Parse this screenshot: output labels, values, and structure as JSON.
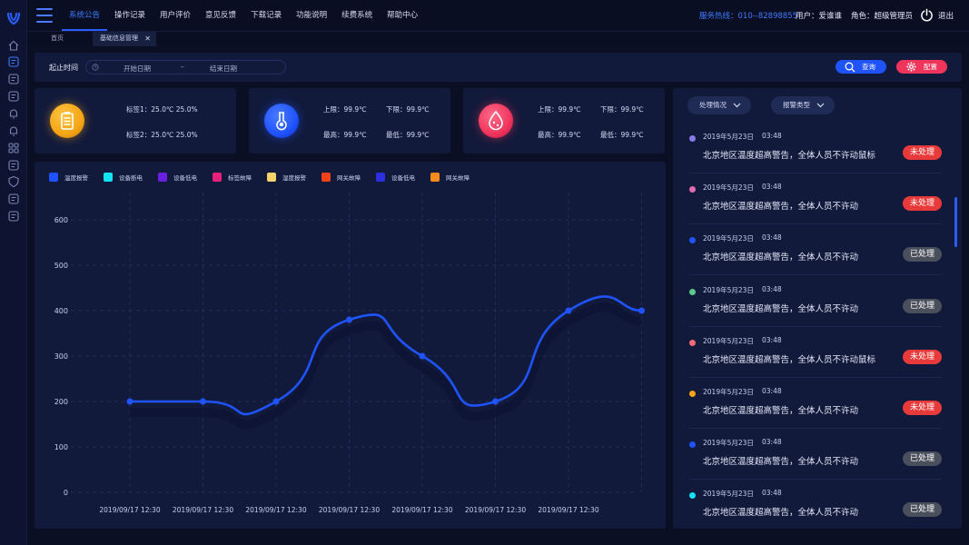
{
  "nav": {
    "items": [
      "系统公告",
      "操作记录",
      "用户评价",
      "意见反馈",
      "下载记录",
      "功能说明",
      "续费系统",
      "帮助中心"
    ],
    "active_index": 0,
    "hotline": "服务热线：010--82898855",
    "user": "用户：爱谁谁",
    "role": "角色：超级管理员",
    "logout": "退出"
  },
  "tabs": {
    "home": "首页",
    "current": "基础信息管理",
    "close": "✕"
  },
  "sidebar": {
    "icons": [
      "home-icon",
      "document-icon",
      "monitor-icon",
      "settings-list-icon",
      "alarm-bell-icon",
      "bell-icon",
      "grid-icon",
      "message-icon",
      "shield-icon",
      "file-icon",
      "search-file-icon"
    ],
    "active_index": 1
  },
  "filter": {
    "label": "起止时间",
    "start_placeholder": "开始日期",
    "separator": "–",
    "end_placeholder": "结束日期",
    "query_label": "查询",
    "config_label": "配置"
  },
  "cards": [
    {
      "icon": "battery-icon",
      "color": "#f5a515",
      "line1a": "标签1：25.0℃  25.0%",
      "line2a": "标签2：25.0℃  25.0%"
    },
    {
      "icon": "thermometer-icon",
      "color": "#1f53ff",
      "upper": "上限：99.9℃",
      "lower": "下限：99.9℃",
      "max": "最高：99.9℃",
      "min": "最低：99.9℃"
    },
    {
      "icon": "humidity-icon",
      "color": "#f0355d",
      "upper": "上限：99.9℃",
      "lower": "下限：99.9℃",
      "max": "最高：99.9℃",
      "min": "最低：99.9℃"
    }
  ],
  "legend": [
    {
      "name": "温度报警",
      "color": "#1f53ff"
    },
    {
      "name": "设备断电",
      "color": "#13e2f0"
    },
    {
      "name": "设备低电",
      "color": "#6b1fe0"
    },
    {
      "name": "标签故障",
      "color": "#e8207a"
    },
    {
      "name": "湿度报警",
      "color": "#f5d36b"
    },
    {
      "name": "网关故障",
      "color": "#f0421a"
    },
    {
      "name": "设备低电",
      "color": "#2b2fe0"
    },
    {
      "name": "网关故障",
      "color": "#f58a1f"
    }
  ],
  "chart_data": {
    "type": "line",
    "categories": [
      "2019/09/17 12:30",
      "2019/09/17 12:30",
      "2019/09/17 12:30",
      "2019/09/17 12:30",
      "2019/09/17 12:30",
      "2019/09/17 12:30",
      "2019/09/17 12:30"
    ],
    "x": [
      0,
      1,
      2,
      3,
      4,
      5,
      6,
      7
    ],
    "values": [
      200,
      200,
      200,
      380,
      300,
      200,
      400,
      400
    ],
    "yticks": [
      0,
      100,
      200,
      300,
      400,
      500,
      600
    ],
    "ylim": [
      0,
      600
    ],
    "line_color": "#1f53ff",
    "smooth": true,
    "grid": true,
    "legend_position": "top-left"
  },
  "alarms": {
    "filter1": "处理情况",
    "filter2": "报警类型",
    "items": [
      {
        "date": "2019年5月23日",
        "time": "03:48",
        "msg": "北京地区温度超高警告，全体人员不许动鼠标",
        "status": "未处理",
        "dot": "#8a7be8"
      },
      {
        "date": "2019年5月23日",
        "time": "03:48",
        "msg": "北京地区温度超高警告，全体人员不许动",
        "status": "未处理",
        "dot": "#e06bb0"
      },
      {
        "date": "2019年5月23日",
        "time": "03:48",
        "msg": "北京地区温度超高警告，全体人员不许动",
        "status": "已处理",
        "dot": "#1f53ff"
      },
      {
        "date": "2019年5月23日",
        "time": "03:48",
        "msg": "北京地区温度超高警告，全体人员不许动",
        "status": "已处理",
        "dot": "#5ec98a"
      },
      {
        "date": "2019年5月23日",
        "time": "03:48",
        "msg": "北京地区温度超高警告，全体人员不许动鼠标",
        "status": "未处理",
        "dot": "#f06b75"
      },
      {
        "date": "2019年5月23日",
        "time": "03:48",
        "msg": "北京地区温度超高警告，全体人员不许动",
        "status": "未处理",
        "dot": "#f5a515"
      },
      {
        "date": "2019年5月23日",
        "time": "03:48",
        "msg": "北京地区温度超高警告，全体人员不许动",
        "status": "已处理",
        "dot": "#1f53ff"
      },
      {
        "date": "2019年5月23日",
        "time": "03:48",
        "msg": "北京地区温度超高警告，全体人员不许动",
        "status": "已处理",
        "dot": "#13e2f0"
      }
    ],
    "colors": {
      "未处理": "#e83a3a",
      "已处理": "#4a4f5c"
    }
  }
}
